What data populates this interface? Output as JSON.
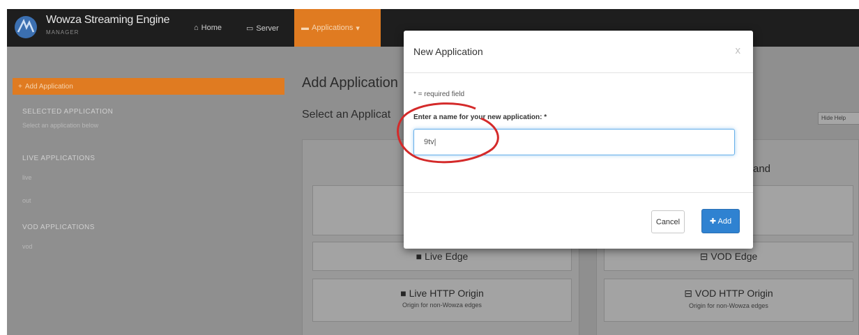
{
  "navbar": {
    "brand": "Wowza Streaming Engine",
    "brand_sub": "MANAGER",
    "home": "Home",
    "server": "Server",
    "applications": "Applications"
  },
  "sidebar": {
    "add_application": "Add Application",
    "selected_heading": "SELECTED APPLICATION",
    "selected_hint": "Select an application below",
    "live_heading": "LIVE APPLICATIONS",
    "live_items": [
      "live",
      "out"
    ],
    "vod_heading": "VOD APPLICATIONS",
    "vod_items": [
      "vod"
    ]
  },
  "main": {
    "title": "Add Application",
    "subtitle": "Select an Applicat",
    "help_button": "Hide Help",
    "demand_label": "and",
    "cards": {
      "live_edge": {
        "label": "Live Edge"
      },
      "vod_edge": {
        "label": "VOD Edge"
      },
      "live_http_origin": {
        "label": "Live HTTP Origin",
        "desc": "Origin for non-Wowza edges"
      },
      "vod_http_origin": {
        "label": "VOD HTTP Origin",
        "desc": "Origin for non-Wowza edges"
      }
    }
  },
  "modal": {
    "title": "New Application",
    "close": "x",
    "required_note": "* = required field",
    "name_label": "Enter a name for your new application: *",
    "name_value": "9tv|",
    "cancel": "Cancel",
    "add": "Add"
  },
  "colors": {
    "accent": "#e07b21",
    "primary": "#2f82d1",
    "annotation": "#d42a2a"
  }
}
